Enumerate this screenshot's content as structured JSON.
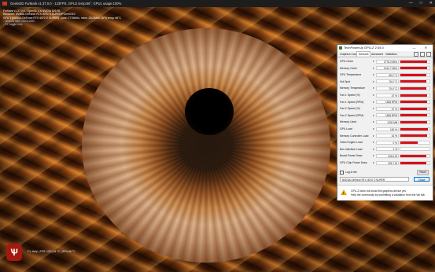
{
  "window": {
    "title": "Geeks3D FurMark v1.37.0.0 - 123FPS, GPU1 temp:66°, GPU1 usage:100%",
    "controls": [
      "—",
      "□",
      "✕"
    ]
  },
  "osd": [
    "FurMark v1.37.0.0 - OpenGL 4.6 NVIDIA 526.98",
    "Renderer: NVIDIA GeForce RTX 4070 Ti SUPER/PCIe/SSE2",
    "GPU 1 (NVIDIA GeForce RTX 4070 Ti SUPER) - core: 2775MHz, mem: 1312MHz, GPU temp: 66°C",
    "- Window size: 1920x1080",
    "- F1: toggle help"
  ],
  "bottom_status": "F1: Help | FPS: 123 | 34 °C | GPU 66 °C",
  "logo_text": "Ѱ",
  "gpuz": {
    "title": "TechPowerUp GPU-Z 2.54.0",
    "title_controls": "— ✕",
    "tabs": [
      "Graphics Card",
      "Sensors",
      "Advanced",
      "Validation"
    ],
    "active_tab": "Sensors",
    "sensors": [
      {
        "label": "GPU Clock",
        "value": "2775.0 MHz",
        "level": 0.93
      },
      {
        "label": "Memory Clock",
        "value": "1312.7 MHz",
        "level": 0.93
      },
      {
        "label": "GPU Temperature",
        "value": "66.0 °C",
        "level": 0.88
      },
      {
        "label": "Hot Spot",
        "value": "76.0 °C",
        "level": 0.9
      },
      {
        "label": "Memory Temperature",
        "value": "70.0 °C",
        "level": 0.9
      },
      {
        "label": "Fan 1 Speed (%)",
        "value": "47 %",
        "level": 0.92
      },
      {
        "label": "Fan 1 Speed (RPM)",
        "value": "1528 RPM",
        "level": 0.92
      },
      {
        "label": "Fan 2 Speed (%)",
        "value": "47 %",
        "level": 0.92
      },
      {
        "label": "Fan 2 Speed (RPM)",
        "value": "1528 RPM",
        "level": 0.92
      },
      {
        "label": "Memory Used",
        "value": "1232 MB",
        "level": 0.92
      },
      {
        "label": "GPU Load",
        "value": "100 %",
        "level": 0.95
      },
      {
        "label": "Memory Controller Load",
        "value": "41 %",
        "level": 0.92
      },
      {
        "label": "Video Engine Load",
        "value": "0 %",
        "level": 0.6
      },
      {
        "label": "Bus Interface Load",
        "value": "1 %",
        "level": 0.0
      },
      {
        "label": "Board Power Draw",
        "value": "243.6 W",
        "level": 0.9
      },
      {
        "label": "GPU Chip Power Draw",
        "value": "225.7 W",
        "level": 0.9
      }
    ],
    "log_label": "Log to file",
    "reset_label": "Reset",
    "gpu_select": "NVIDIA GeForce RTX 4070 Ti SUPER",
    "close_label": "Close",
    "notice_line1": "GPU-Z does not know this graphics device yet.",
    "notice_line2": "Help the community by submitting a validation from the Val tab."
  },
  "colors": {
    "bar": "#d4111b",
    "accent_icon": "#3a7d3a",
    "warning": "#e8a200"
  }
}
